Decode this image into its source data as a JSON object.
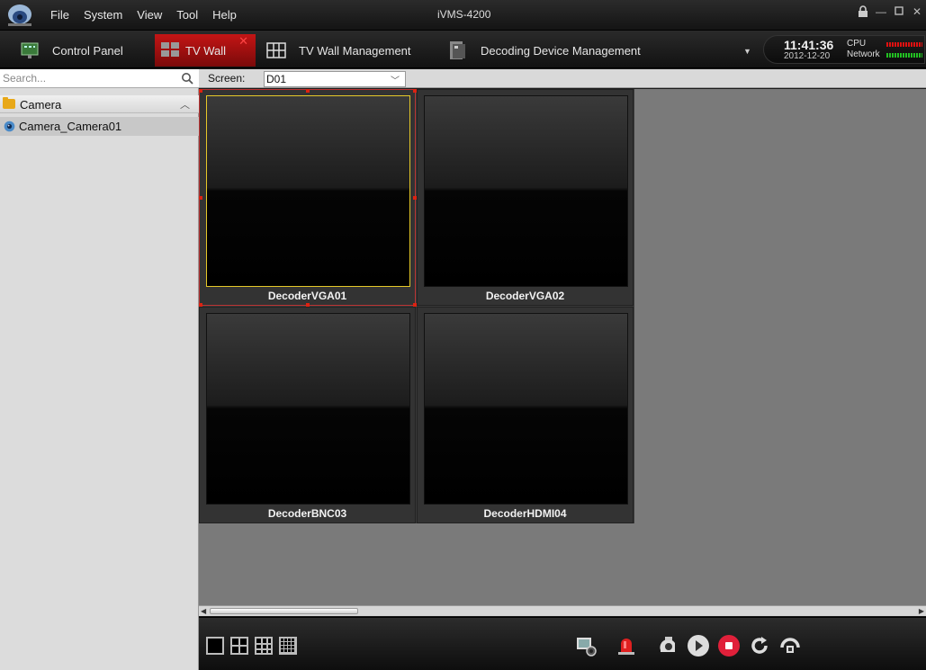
{
  "menu": [
    "File",
    "System",
    "View",
    "Tool",
    "Help"
  ],
  "app_title": "iVMS-4200",
  "window_controls": [
    "lock-icon",
    "minimize-icon",
    "restore-icon",
    "close-icon"
  ],
  "tabs": [
    {
      "label": "Control Panel",
      "icon": "control-panel-icon"
    },
    {
      "label": "TV Wall",
      "icon": "tv-wall-icon",
      "active": true
    },
    {
      "label": "TV Wall Management",
      "icon": "grid-icon"
    },
    {
      "label": "Decoding Device Management",
      "icon": "decoder-icon"
    }
  ],
  "status": {
    "time": "11:41:36",
    "date": "2012-12-20",
    "cpu_label": "CPU",
    "network_label": "Network"
  },
  "search": {
    "placeholder": "Search..."
  },
  "tree": {
    "group": "Camera",
    "items": [
      "Camera_Camera01"
    ]
  },
  "screen": {
    "label": "Screen:",
    "value": "D01"
  },
  "wall": {
    "cells": [
      "DecoderVGA01",
      "DecoderVGA02",
      "DecoderBNC03",
      "DecoderHDMI04"
    ],
    "selected": "DecoderVGA01"
  },
  "toolbar": {
    "layouts": [
      "1x1",
      "2x2",
      "3x3",
      "4x4"
    ],
    "tools": [
      "capture-icon",
      "alarm-icon",
      "ptz-icon",
      "play-icon",
      "stop-icon",
      "refresh-icon",
      "lock-screen-icon"
    ]
  },
  "colors": {
    "active_tab": "#c31515",
    "selected_border": "#e5c829",
    "stop_button": "#e0203a"
  }
}
